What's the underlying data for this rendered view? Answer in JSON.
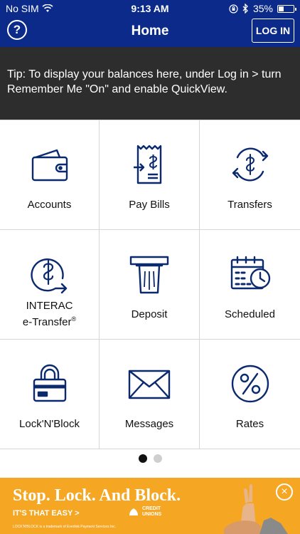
{
  "status_bar": {
    "carrier": "No SIM",
    "time": "9:13 AM",
    "battery": "35%",
    "battery_level": 0.35
  },
  "nav": {
    "help_label": "?",
    "title": "Home",
    "login_label": "LOG IN"
  },
  "tip": {
    "text": "Tip: To display your balances here, under Log in > turn Remember Me \"On\" and enable QuickView."
  },
  "tiles": [
    {
      "label": "Accounts",
      "icon": "wallet-icon"
    },
    {
      "label": "Pay Bills",
      "icon": "bill-icon"
    },
    {
      "label": "Transfers",
      "icon": "transfer-icon"
    },
    {
      "label_line1": "INTERAC",
      "label_line2": "e-Transfer",
      "label_mark": "®",
      "icon": "etransfer-icon"
    },
    {
      "label": "Deposit",
      "icon": "deposit-icon"
    },
    {
      "label": "Scheduled",
      "icon": "calendar-clock-icon"
    },
    {
      "label": "Lock'N'Block",
      "icon": "lock-card-icon"
    },
    {
      "label": "Messages",
      "icon": "envelope-icon"
    },
    {
      "label": "Rates",
      "icon": "percent-icon"
    }
  ],
  "pager": {
    "pages": 2,
    "active": 0
  },
  "ad": {
    "headline": "Stop. Lock. And Block.",
    "cta": "IT'S THAT EASY >",
    "logo_line1": "CREDIT",
    "logo_line2": "UNIONS",
    "fine_print": "LOCK'N'BLOCK is a trademark of Everlink Payment Services Inc.",
    "close_label": "×"
  },
  "colors": {
    "brand": "#0b2a8a",
    "icon": "#0b2a6e",
    "tip_bg": "#2d2d2d",
    "ad_bg": "#f5a623"
  }
}
